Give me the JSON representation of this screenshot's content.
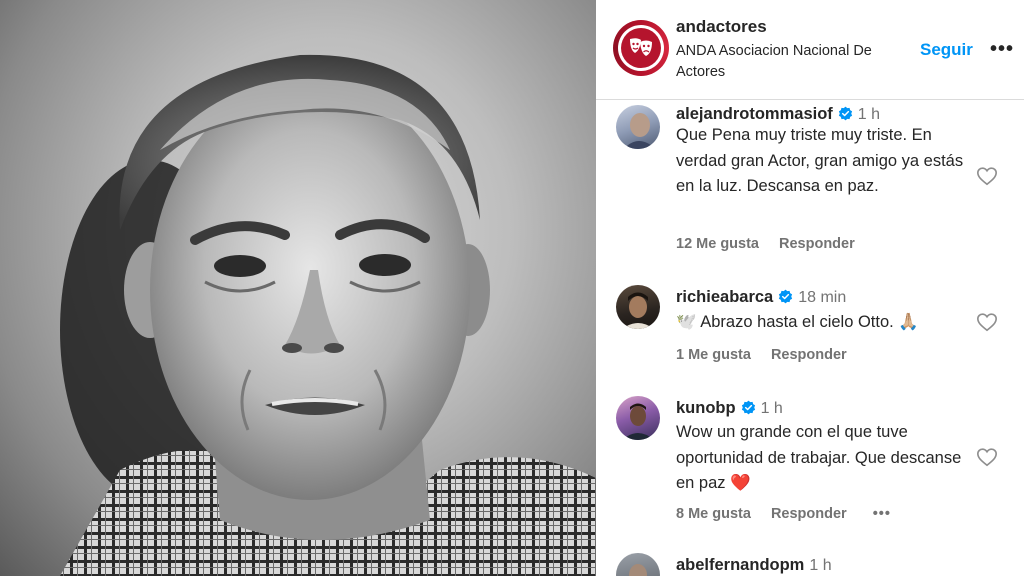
{
  "post": {
    "image_alt": "Black and white portrait of an older man in a plaid shirt"
  },
  "header": {
    "username": "andactores",
    "full_name": "ANDA Asociacion Nacional De Actores",
    "follow_label": "Seguir",
    "more_icon": "more-horizontal-icon",
    "more_label": "•••"
  },
  "comments": [
    {
      "username": "alejandrotommasiof",
      "verified": true,
      "time": "1 h",
      "text": "Que Pena muy triste muy triste. En verdad gran Actor, gran amigo ya estás en la luz. Descansa en paz.",
      "likes": "12 Me gusta",
      "reply": "Responder"
    },
    {
      "username": "richieabarca",
      "verified": true,
      "time": "18 min",
      "text": "🕊️ Abrazo hasta el cielo Otto. 🙏🏼",
      "likes": "1 Me gusta",
      "reply": "Responder"
    },
    {
      "username": "kunobp",
      "verified": true,
      "time": "1 h",
      "text": "Wow un grande con el que tuve oportunidad de trabajar. Que descanse en paz ❤️",
      "likes": "8 Me gusta",
      "reply": "Responder",
      "more_label": "•••"
    },
    {
      "username": "abelfernandopm",
      "verified": false,
      "time": "1 h"
    }
  ],
  "colors": {
    "link": "#0095f6",
    "verified": "#0095f6",
    "secondary_text": "#737373",
    "brand": "#b5142d"
  }
}
